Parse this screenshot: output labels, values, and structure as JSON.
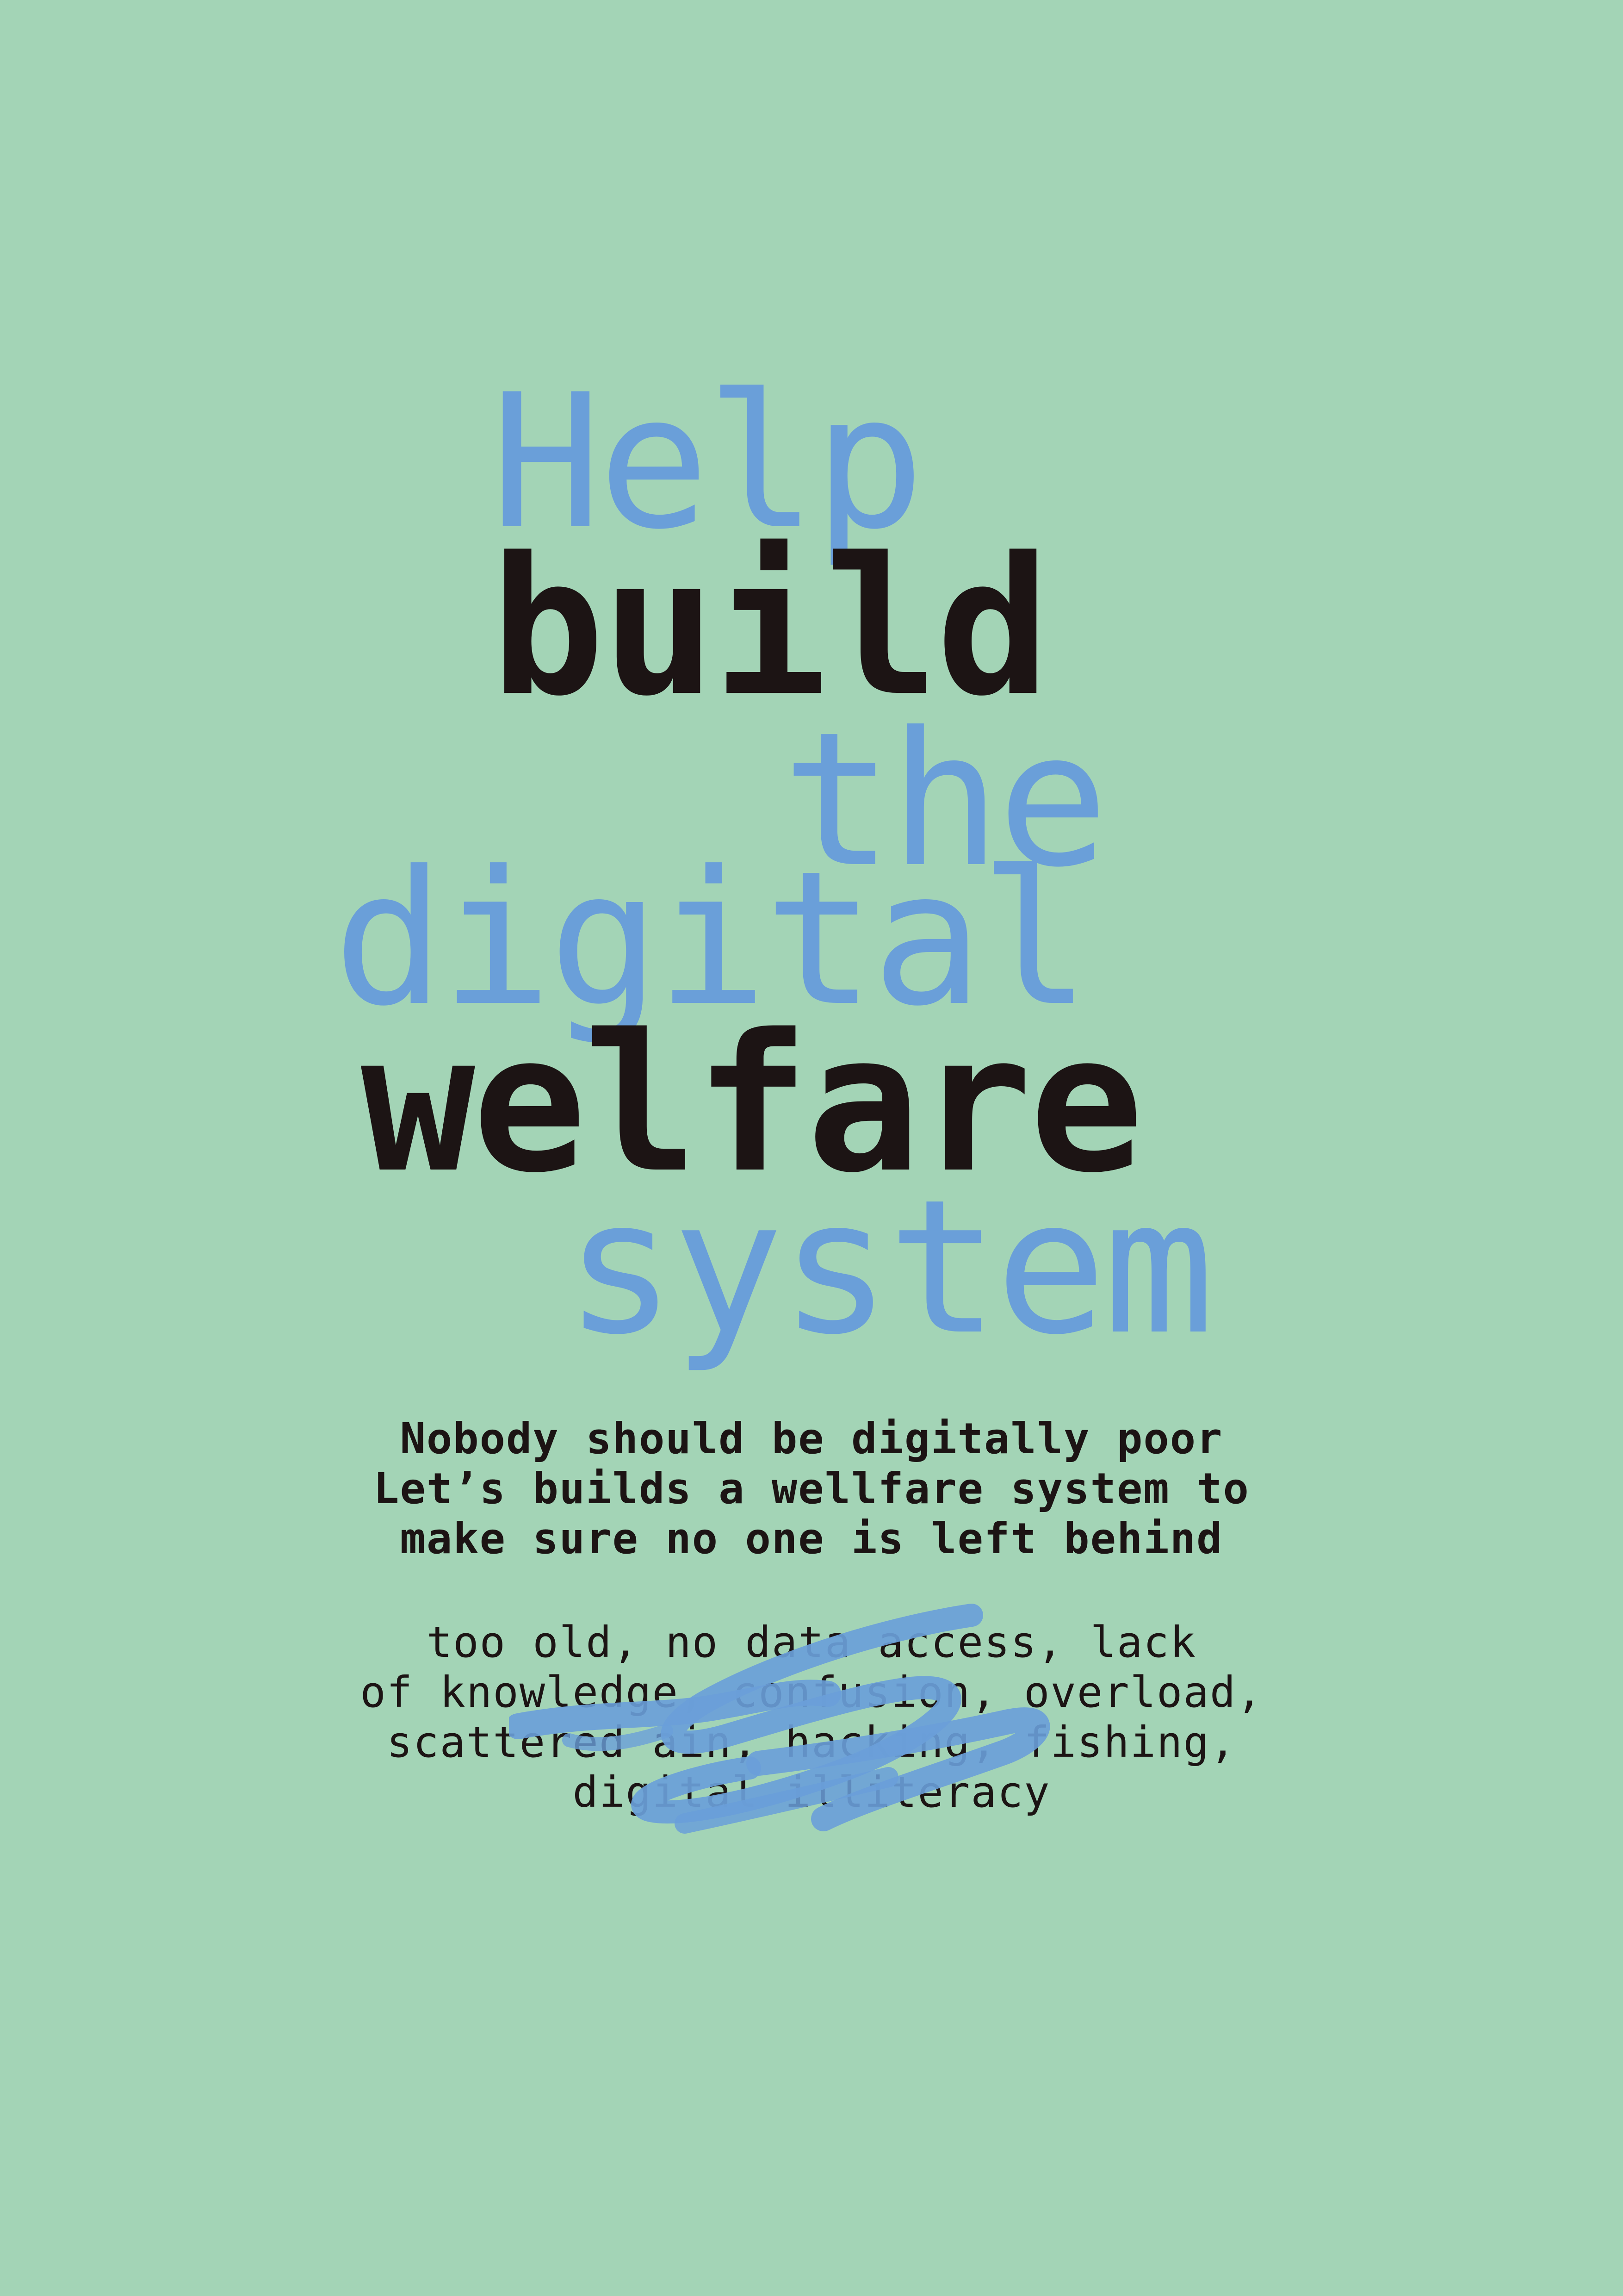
{
  "headline": {
    "words": [
      "Help",
      "build",
      "the",
      "digital",
      "welfare",
      "system"
    ]
  },
  "statement": {
    "lines": [
      "Nobody should be digitally poor",
      "Let’s builds a wellfare system to",
      "make sure no one is left behind"
    ]
  },
  "barriers": {
    "lines": [
      "too old, no data access, lack",
      "of knowledge, confusion, overload,",
      "scattered ain, hacking, fishing,",
      "digital illiteracy"
    ]
  },
  "colors": {
    "background": "#a3d4b6",
    "accent_blue": "#6a9fd9",
    "text_dark": "#1c1414"
  },
  "decorations": {
    "scribble": "blue-brush-scribble"
  }
}
